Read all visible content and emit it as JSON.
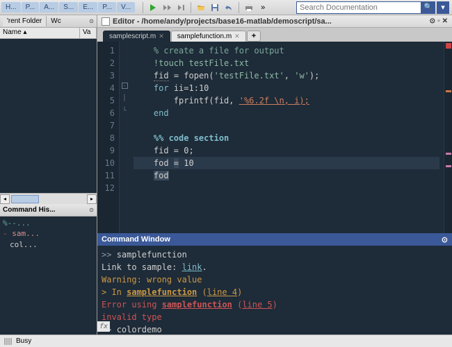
{
  "top_tabs": [
    "H...",
    "P...",
    "A...",
    "S...",
    "E...",
    "P...",
    "V..."
  ],
  "search": {
    "placeholder": "Search Documentation"
  },
  "folder_panel": {
    "tab1": "'rent Folder",
    "tab2": "Wc",
    "col_name": "Name",
    "col_val": "Va"
  },
  "cmd_history": {
    "title": "Command His...",
    "items": [
      {
        "text": "%--...",
        "cls": "ch-sec"
      },
      {
        "text": "sam...",
        "cls": "ch-err ind"
      },
      {
        "text": "col...",
        "cls": "ind"
      }
    ]
  },
  "editor": {
    "title": "Editor - /home/andy/projects/base16-matlab/demoscript/sa...",
    "tabs": [
      {
        "label": "samplescript.m",
        "active": true
      },
      {
        "label": "samplefunction.m",
        "active": false
      }
    ],
    "lines": [
      {
        "n": 1,
        "html": "    <span class='cmt'>% create a file for output</span>"
      },
      {
        "n": 2,
        "html": "    <span class='str'>!touch testFile.txt</span>"
      },
      {
        "n": 3,
        "html": "    <span class='var-u'>fid</span> = fopen(<span class='str'>'testFile.txt'</span>, <span class='str'>'w'</span>);"
      },
      {
        "n": 4,
        "html": "    <span class='kwd'>for</span> ii=1:10",
        "fold": "-"
      },
      {
        "n": 5,
        "html": "        fprintf(fid, <span class='fmt'>'%6.2f \\n, i);</span>",
        "fold": "|"
      },
      {
        "n": 6,
        "html": "    <span class='kwd'>end</span>",
        "fold": "└"
      },
      {
        "n": 7,
        "html": ""
      },
      {
        "n": 8,
        "html": "    <span class='sec-head'>%% code section</span>"
      },
      {
        "n": 9,
        "html": "    fid = 0;"
      },
      {
        "n": 10,
        "html": "    fod <span class='var-hl'>=</span> 10",
        "hl": true
      },
      {
        "n": 11,
        "html": "    <span class='var-hl'>fod</span>"
      },
      {
        "n": 12,
        "html": ""
      }
    ]
  },
  "cmd_window": {
    "title": "Command Window",
    "lines": [
      {
        "html": "<span class='cw-prompt'>>> </span>samplefunction"
      },
      {
        "html": "Link to sample: <span class='cw-link'>link</span>."
      },
      {
        "html": "<span class='cw-warn'>Warning: wrong value</span>"
      },
      {
        "html": "<span class='cw-warn'>> In <b><u>samplefunction</u></b> (<u>line 4</u>)</span>"
      },
      {
        "html": "<span class='cw-err'>Error using <b><u>samplefunction</u></b> (<u>line 5</u>)</span>"
      },
      {
        "html": "<span class='cw-err'>invalid type</span>"
      },
      {
        "html": "<span class='cw-prompt'>>> </span>colordemo"
      }
    ]
  },
  "status": {
    "text": "Busy"
  }
}
